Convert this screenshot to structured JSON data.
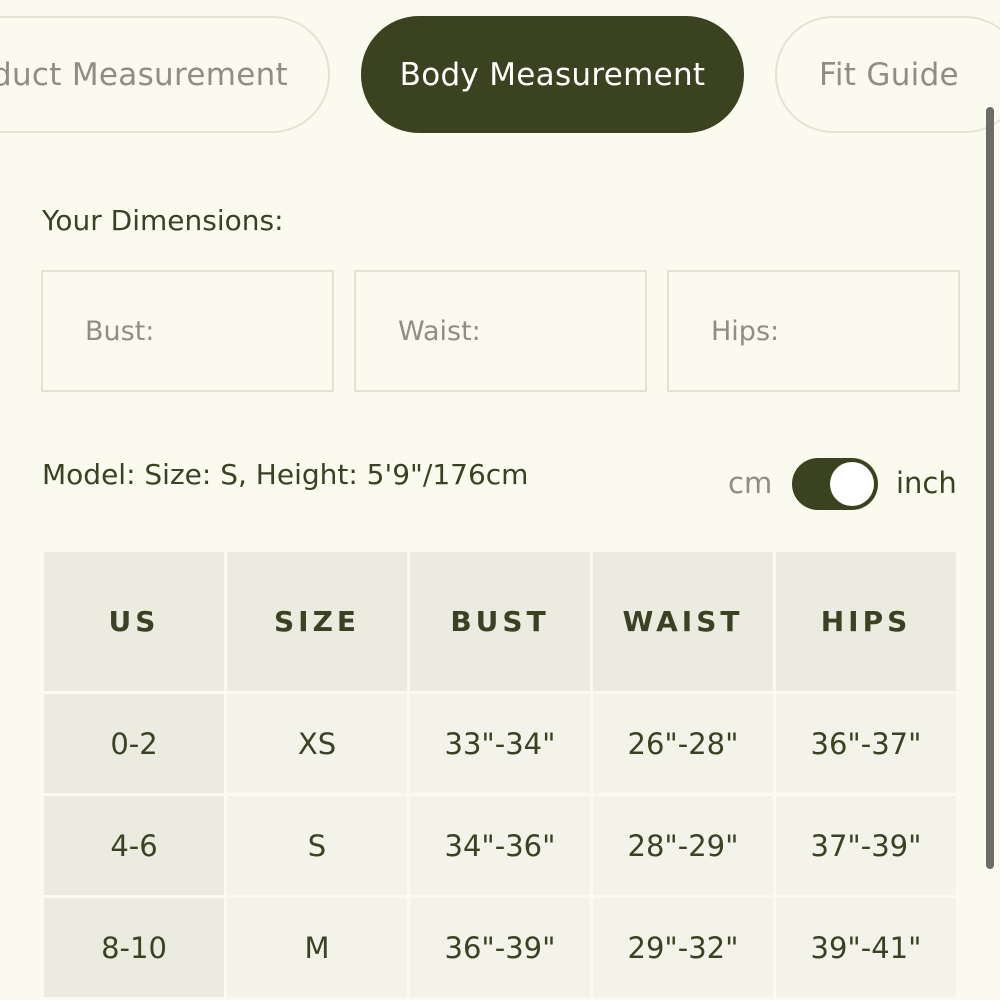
{
  "tabs": {
    "product": "oduct Measurement",
    "body": "Body Measurement",
    "fit": "Fit Guide"
  },
  "dimensions": {
    "title": "Your Dimensions:",
    "bust_placeholder": "Bust:",
    "waist_placeholder": "Waist:",
    "hips_placeholder": "Hips:"
  },
  "model": {
    "info": "Model: Size: S, Height: 5'9\"/176cm"
  },
  "units": {
    "cm": "cm",
    "inch": "inch",
    "selected": "inch"
  },
  "table": {
    "headers": [
      "US",
      "SIZE",
      "BUST",
      "WAIST",
      "HIPS"
    ],
    "rows": [
      [
        "0-2",
        "XS",
        "33\"-34\"",
        "26\"-28\"",
        "36\"-37\""
      ],
      [
        "4-6",
        "S",
        "34\"-36\"",
        "28\"-29\"",
        "37\"-39\""
      ],
      [
        "8-10",
        "M",
        "36\"-39\"",
        "29\"-32\"",
        "39\"-41\""
      ]
    ]
  },
  "colors": {
    "background": "#fafaef",
    "accent": "#3b4220",
    "text": "#3b4224",
    "muted_text": "#8e8e83",
    "header_cell": "#ecebe0",
    "body_cell": "#f3f3e9",
    "border": "#e3e2d5"
  }
}
